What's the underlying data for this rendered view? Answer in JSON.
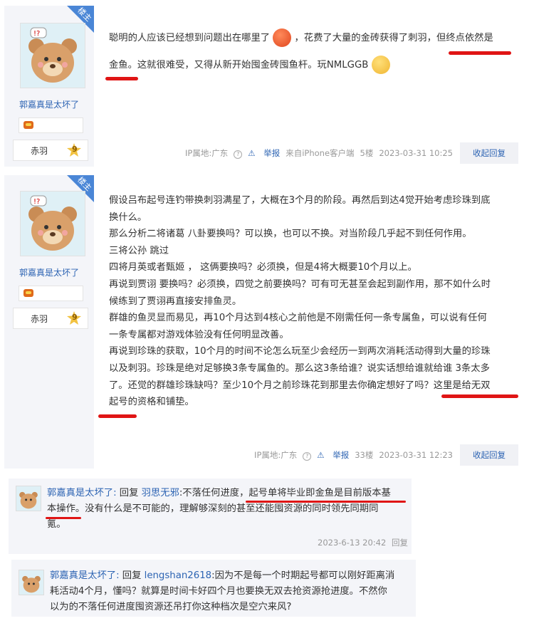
{
  "posts": [
    {
      "badge": "楼主",
      "username": "郭嘉真是太坏了",
      "level_name": "赤羽",
      "level_num": "9",
      "lines": [
        "聪明的人应该已经想到问题出在哪里了",
        "，花费了大量的金砖获得了刺羽，但终点依然是",
        "金鱼。这就很难受，又得从新开始囤金砖囤鱼杆。玩NMLGGB"
      ],
      "ip": "IP属地:广东",
      "report": "举报",
      "client": "来自iPhone客户端",
      "floor": "5楼",
      "time": "2023-03-31 10:25",
      "reply_btn": "收起回复"
    },
    {
      "badge": "楼主",
      "username": "郭嘉真是太坏了",
      "level_name": "赤羽",
      "level_num": "9",
      "lines": [
        "假设吕布起号连钓带换刺羽满星了，大概在3个月的阶段。再然后到达4觉开始考虑珍珠到底",
        "换什么。",
        "那么分析二将诸葛 八卦要换吗？可以换，也可以不换。对当阶段几乎起不到任何作用。",
        "三将公孙 跳过",
        "四将月英或者甄姬 ， 这俩要换吗？必须换，但是4将大概要10个月以上。",
        "再说到贾诩 要换吗？必须换，四觉之前要换吗？可有可无甚至会起到副作用，那不如什么时",
        "候练到了贾诩再直接安排鱼灵。",
        "群雄的鱼灵显而易见，再10个月达到4核心之前他是不刚需任何一条专属鱼，可以说有任何",
        "一条专属都对游戏体验没有任何明显改善。",
        "再说到珍珠的获取，10个月的时间不论怎么玩至少会经历一到两次消耗活动得到大量的珍珠",
        "以及刺羽。珍珠是绝对足够换3条专属鱼的。那么这3条给谁？说实话想给谁就给谁 3条太多",
        "了。还觉的群雄珍珠缺吗？至少10个月之前珍珠花到那里去你确定想好了吗？这里是给无双",
        "起号的资格和铺垫。"
      ],
      "ip": "IP属地:广东",
      "report": "举报",
      "floor": "33楼",
      "time": "2023-03-31 12:23",
      "reply_btn": "收起回复"
    }
  ],
  "replies": [
    {
      "author": "郭嘉真是太坏了:",
      "reply_word": "回复",
      "target": "羽思无邪",
      "lines": [
        ":不落任何进度，起号单将毕业即金鱼是目前版本基",
        "本操作。没有什么是不可能的，理解够深刻的甚至还能囤资源的同时领先同期同",
        "氪。"
      ],
      "time": "2023-6-13 20:42",
      "reply_btn": "回复"
    },
    {
      "author": "郭嘉真是太坏了:",
      "reply_word": "回复",
      "target": "lengshan2618",
      "lines": [
        ":因为不是每一个时期起号都可以刚好距离消",
        "耗活动4个月，懂吗？就算是时间卡好四个月也要换无双去抢资源抢进度。不然你",
        "以为的不落任何进度囤资源还吊打你这种档次是空穴来风?"
      ]
    }
  ],
  "colors": {
    "link": "#2d64b3",
    "sidebar": "#f4f5f9",
    "badge": "#4a86d6",
    "underline": "#e01515"
  }
}
